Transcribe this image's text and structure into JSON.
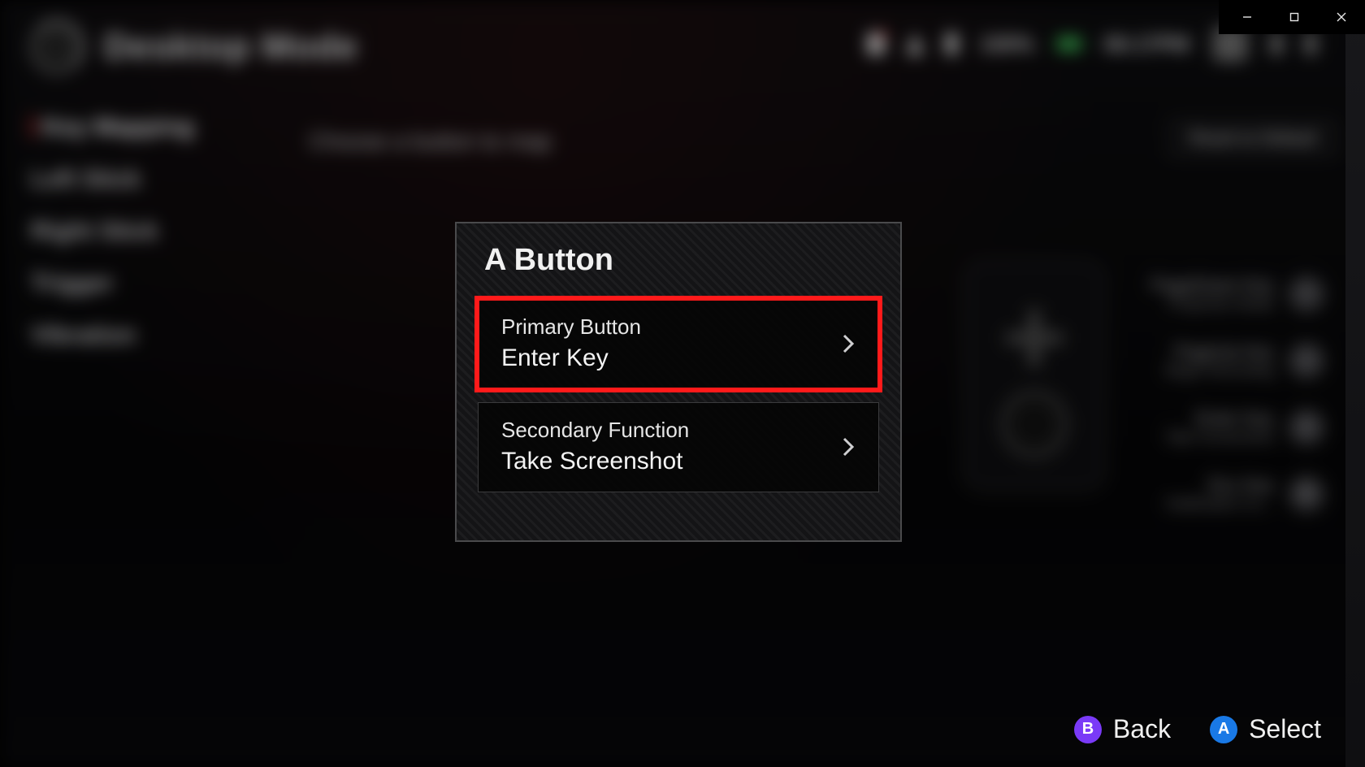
{
  "header": {
    "title": "Desktop Mode",
    "battery_pct": "100%",
    "time": "06:17PM"
  },
  "sidebar": {
    "items": [
      {
        "label": "Key Mapping",
        "active": true
      },
      {
        "label": "Left Stick",
        "active": false
      },
      {
        "label": "Right Stick",
        "active": false
      },
      {
        "label": "Trigger",
        "active": false
      },
      {
        "label": "Vibration",
        "active": false
      }
    ]
  },
  "main": {
    "hint": "Choose a button to map",
    "reset_label": "Reset to Default"
  },
  "right_labels": [
    {
      "key": "PageDown Key",
      "sub": "Projection Mode",
      "btn": "Y"
    },
    {
      "key": "PageUp Key",
      "sub": "Begin Recording",
      "btn": "X"
    },
    {
      "key": "Enter Key",
      "sub": "Take Screenshot",
      "btn": "A"
    },
    {
      "key": "Esc Key",
      "sub": "Notification Ce...",
      "btn": "B"
    }
  ],
  "modal": {
    "title": "A Button",
    "options": [
      {
        "label": "Primary Button",
        "value": "Enter Key",
        "selected": true
      },
      {
        "label": "Secondary Function",
        "value": "Take Screenshot",
        "selected": false
      }
    ]
  },
  "footer": {
    "back": {
      "glyph": "B",
      "label": "Back"
    },
    "select": {
      "glyph": "A",
      "label": "Select"
    }
  },
  "window": {
    "minimize": "—",
    "maximize": "□",
    "close": "✕"
  }
}
